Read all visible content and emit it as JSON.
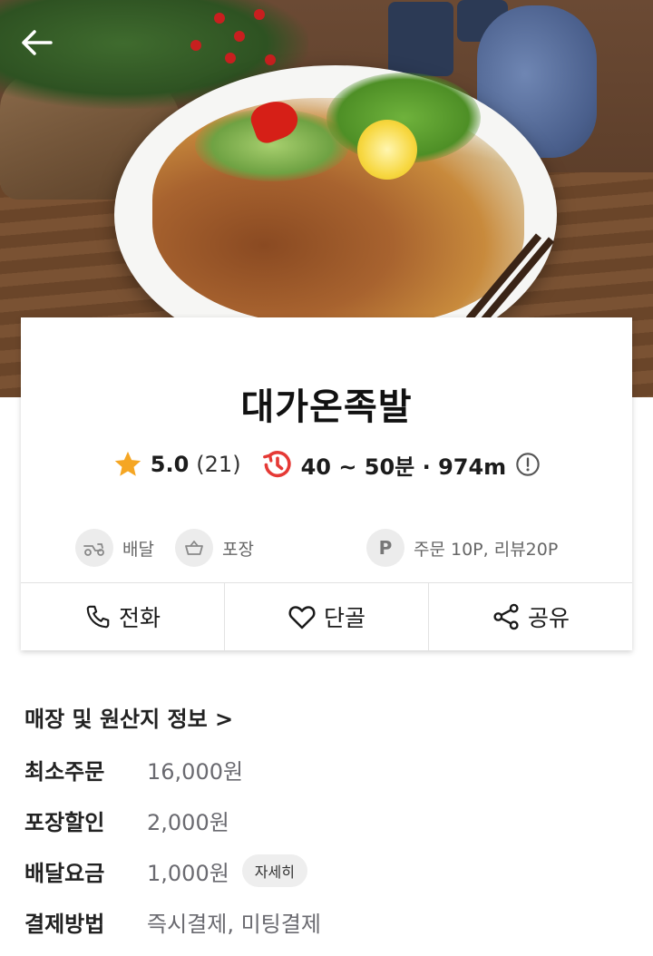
{
  "nav": {
    "back_icon": "arrow-left-icon"
  },
  "store": {
    "name": "대가온족발",
    "rating": "5.0",
    "review_count": "(21)",
    "delivery_time_distance": "40 ~ 50분 · 974m"
  },
  "tags": {
    "delivery": "배달",
    "pickup": "포장",
    "point_symbol": "P",
    "points": "주문 10P, 리뷰20P"
  },
  "actions": {
    "call": "전화",
    "favorite": "단골",
    "share": "공유"
  },
  "info": {
    "store_origin_link": "매장 및 원산지 정보 >",
    "rows": [
      {
        "label": "최소주문",
        "value": "16,000원"
      },
      {
        "label": "포장할인",
        "value": "2,000원"
      },
      {
        "label": "배달요금",
        "value": "1,000원"
      },
      {
        "label": "결제방법",
        "value": "즉시결제, 미팅결제"
      }
    ],
    "detail_chip": "자세히"
  },
  "colors": {
    "star": "#f5a623",
    "clock": "#e53935",
    "value_gray": "#6a6a70"
  }
}
